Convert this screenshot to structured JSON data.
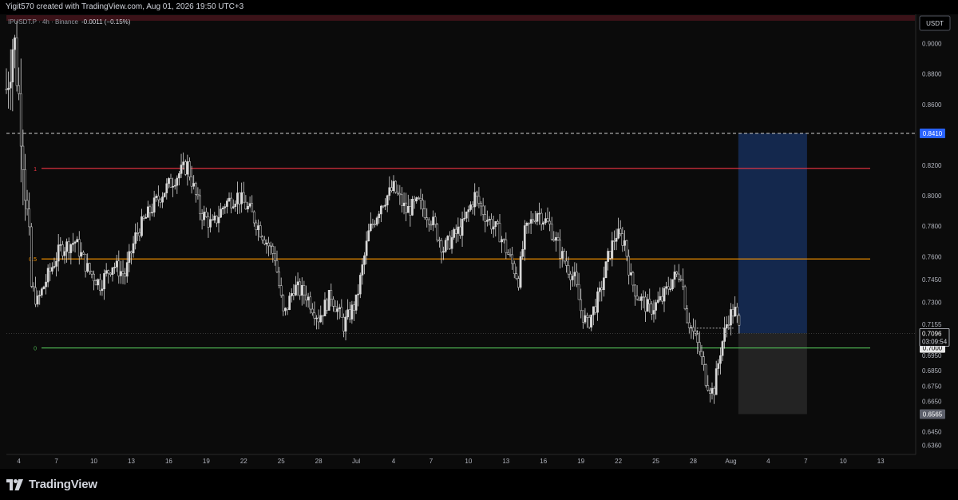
{
  "caption": "Yigit570 created with TradingView.com, Aug 01, 2026 19:50 UTC+3",
  "brand": "TradingView",
  "colors": {
    "background": "#0b0b0b",
    "candle": "#d8d8d8",
    "level_1": "#f23645",
    "level_05": "#ff9800",
    "level_0": "#4caf50",
    "target_zone": "#162b54",
    "stop_zone": "#232323",
    "price_tag_blue": "#2962ff"
  },
  "chart_data": {
    "type": "candlestick",
    "symbol_info": "IPUSDT.P · 4h · Binance",
    "change": "-0.0011 (−0.15%)",
    "currency": "USDT",
    "y_min": 0.63,
    "y_max": 0.915,
    "y_ticks": [
      {
        "value": 0.9,
        "label": "0.9000"
      },
      {
        "value": 0.88,
        "label": "0.8800"
      },
      {
        "value": 0.86,
        "label": "0.8600"
      },
      {
        "value": 0.82,
        "label": "0.8200"
      },
      {
        "value": 0.8,
        "label": "0.8000"
      },
      {
        "value": 0.78,
        "label": "0.7800"
      },
      {
        "value": 0.76,
        "label": "0.7600"
      },
      {
        "value": 0.745,
        "label": "0.7450"
      },
      {
        "value": 0.73,
        "label": "0.7300"
      },
      {
        "value": 0.7155,
        "label": "0.7155"
      },
      {
        "value": 0.695,
        "label": "0.6950"
      },
      {
        "value": 0.685,
        "label": "0.6850"
      },
      {
        "value": 0.675,
        "label": "0.6750"
      },
      {
        "value": 0.665,
        "label": "0.6650"
      },
      {
        "value": 0.645,
        "label": "0.6450"
      },
      {
        "value": 0.636,
        "label": "0.6360"
      }
    ],
    "x_min": 3.0,
    "x_max": 44.8,
    "x_ticks": [
      {
        "value": 4,
        "label": "4"
      },
      {
        "value": 7,
        "label": "7"
      },
      {
        "value": 10,
        "label": "10"
      },
      {
        "value": 13,
        "label": "13"
      },
      {
        "value": 16,
        "label": "16"
      },
      {
        "value": 19,
        "label": "19"
      },
      {
        "value": 22,
        "label": "22"
      },
      {
        "value": 25,
        "label": "25"
      },
      {
        "value": 28,
        "label": "28"
      },
      {
        "value": 31,
        "label": "Jul"
      },
      {
        "value": 34,
        "label": "4"
      },
      {
        "value": 37,
        "label": "7"
      },
      {
        "value": 40,
        "label": "10"
      },
      {
        "value": 43,
        "label": "13"
      },
      {
        "value": 46,
        "label": "16"
      },
      {
        "value": 49,
        "label": "19"
      },
      {
        "value": 52,
        "label": "22"
      },
      {
        "value": 55,
        "label": "25"
      },
      {
        "value": 58,
        "label": "28"
      },
      {
        "value": 61,
        "label": "Aug"
      },
      {
        "value": 64,
        "label": "4"
      },
      {
        "value": 67,
        "label": "7"
      },
      {
        "value": 70,
        "label": "10"
      },
      {
        "value": 73,
        "label": "13"
      }
    ],
    "x_range_days": [
      3.0,
      75.8
    ],
    "candles_end_day": 61.7,
    "fib_levels": [
      {
        "label": "1",
        "value": 0.818
      },
      {
        "label": "0.5",
        "value": 0.7585
      },
      {
        "label": "0",
        "value": 0.7
      }
    ],
    "resistance_dashed": 0.841,
    "position": {
      "start_day": 61.6,
      "end_day": 67.1,
      "entry": 0.7096,
      "target": 0.841,
      "stop": 0.6565
    },
    "last_price": {
      "value_label": "0.7096",
      "countdown": "03:09:54",
      "value": 0.7096
    },
    "price_tags": [
      {
        "value": 0.841,
        "label": "0.8410",
        "style": "blue"
      },
      {
        "value": 0.7,
        "label": "0.7000",
        "style": "white"
      },
      {
        "value": 0.6565,
        "label": "0.6565",
        "style": "grey"
      }
    ],
    "anchors": [
      [
        3.0,
        0.87
      ],
      [
        3.6,
        0.905
      ],
      [
        4.3,
        0.835
      ],
      [
        5.0,
        0.74
      ],
      [
        5.5,
        0.73
      ],
      [
        6.2,
        0.745
      ],
      [
        7.3,
        0.765
      ],
      [
        8.5,
        0.77
      ],
      [
        9.5,
        0.752
      ],
      [
        10.5,
        0.742
      ],
      [
        11.5,
        0.755
      ],
      [
        12.5,
        0.748
      ],
      [
        13.4,
        0.775
      ],
      [
        14.5,
        0.79
      ],
      [
        15.3,
        0.8
      ],
      [
        16.5,
        0.812
      ],
      [
        17.5,
        0.82
      ],
      [
        18.5,
        0.79
      ],
      [
        19.5,
        0.78
      ],
      [
        20.5,
        0.795
      ],
      [
        21.5,
        0.8
      ],
      [
        22.5,
        0.79
      ],
      [
        23.5,
        0.775
      ],
      [
        24.5,
        0.76
      ],
      [
        25.2,
        0.72
      ],
      [
        26.0,
        0.74
      ],
      [
        27.0,
        0.735
      ],
      [
        28.0,
        0.72
      ],
      [
        29.0,
        0.735
      ],
      [
        30.0,
        0.715
      ],
      [
        31.0,
        0.73
      ],
      [
        32.0,
        0.775
      ],
      [
        33.0,
        0.795
      ],
      [
        34.0,
        0.805
      ],
      [
        35.0,
        0.79
      ],
      [
        36.0,
        0.795
      ],
      [
        37.0,
        0.785
      ],
      [
        38.0,
        0.765
      ],
      [
        39.5,
        0.78
      ],
      [
        40.5,
        0.8
      ],
      [
        41.5,
        0.785
      ],
      [
        42.5,
        0.775
      ],
      [
        43.5,
        0.755
      ],
      [
        44.0,
        0.745
      ],
      [
        44.5,
        0.775
      ],
      [
        45.5,
        0.79
      ],
      [
        46.5,
        0.78
      ],
      [
        47.5,
        0.76
      ],
      [
        48.5,
        0.745
      ],
      [
        49.0,
        0.725
      ],
      [
        49.5,
        0.715
      ],
      [
        50.5,
        0.735
      ],
      [
        51.2,
        0.76
      ],
      [
        51.8,
        0.775
      ],
      [
        52.5,
        0.77
      ],
      [
        53.0,
        0.745
      ],
      [
        53.5,
        0.735
      ],
      [
        54.5,
        0.725
      ],
      [
        55.5,
        0.732
      ],
      [
        56.3,
        0.745
      ],
      [
        57.0,
        0.75
      ],
      [
        57.5,
        0.72
      ],
      [
        58.0,
        0.71
      ],
      [
        58.5,
        0.698
      ],
      [
        59.0,
        0.68
      ],
      [
        59.6,
        0.67
      ],
      [
        60.2,
        0.7
      ],
      [
        60.8,
        0.72
      ],
      [
        61.3,
        0.725
      ],
      [
        61.7,
        0.711
      ]
    ]
  }
}
